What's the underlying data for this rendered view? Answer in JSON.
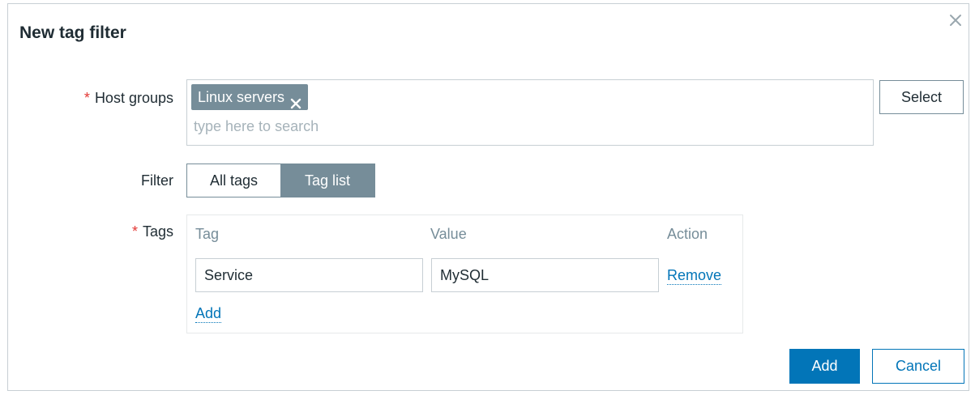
{
  "dialog": {
    "title": "New tag filter",
    "close_icon": "close-icon"
  },
  "host_groups": {
    "required_marker": "*",
    "label": "Host groups",
    "selected": [
      {
        "name": "Linux servers",
        "remove_icon": "close-icon"
      }
    ],
    "placeholder": "type here to search",
    "value": "",
    "select_label": "Select"
  },
  "filter": {
    "label": "Filter",
    "options": [
      "All tags",
      "Tag list"
    ],
    "selected": "Tag list"
  },
  "tags": {
    "required_marker": "*",
    "label": "Tags",
    "columns": [
      "Tag",
      "Value",
      "Action"
    ],
    "rows": [
      {
        "tag": "Service",
        "value": "MySQL",
        "action": "Remove"
      }
    ],
    "add_label": "Add"
  },
  "footer": {
    "add_label": "Add",
    "cancel_label": "Cancel"
  },
  "colors": {
    "primary": "#0275b8",
    "chip": "#768d99",
    "required": "#e33734"
  }
}
